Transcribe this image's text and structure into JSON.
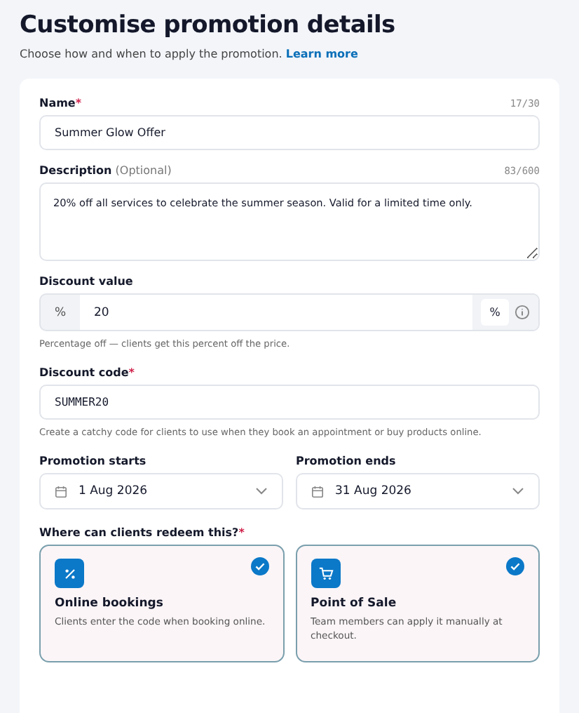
{
  "header": {
    "title": "Customise promotion details",
    "subtitle": "Choose how and when to apply the promotion.",
    "link": "Learn more"
  },
  "name_field": {
    "label": "Name",
    "required_mark": "*",
    "counter": "17/30",
    "value": "Summer Glow Offer"
  },
  "description_field": {
    "label": "Description",
    "hint": "(Optional)",
    "counter": "83/600",
    "value": "20% off all services to celebrate the summer season. Valid for a limited time only."
  },
  "discount_value": {
    "label": "Discount value",
    "prefix": "%",
    "value": "20",
    "unit": "%",
    "helper": "Percentage off — clients get this percent off the price."
  },
  "discount_code": {
    "label": "Discount code",
    "required_mark": "*",
    "value": "SUMMER20",
    "helper": "Create a catchy code for clients to use when they book an appointment or buy products online."
  },
  "dates": [
    {
      "label": "Promotion starts",
      "value": "1 Aug 2026"
    },
    {
      "label": "Promotion ends",
      "value": "31 Aug 2026"
    }
  ],
  "redeem": {
    "label": "Where can clients redeem this?",
    "required_mark": "*",
    "options": [
      {
        "kind": "online",
        "title": "Online bookings",
        "description": "Clients enter the code when booking online.",
        "checked": true
      },
      {
        "kind": "pos",
        "title": "Point of Sale",
        "description": "Team members can apply it manually at checkout.",
        "checked": true
      }
    ]
  }
}
